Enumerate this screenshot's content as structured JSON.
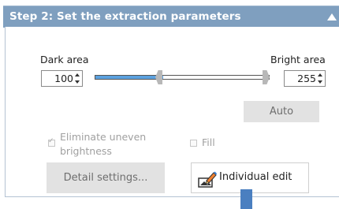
{
  "header": {
    "title": "Step 2: Set the extraction parameters"
  },
  "slider": {
    "dark_label": "Dark area",
    "bright_label": "Bright area",
    "dark_value": "100",
    "bright_value": "255",
    "dark_fill_fraction": 0.39,
    "bright_fraction": 1.0
  },
  "buttons": {
    "auto": "Auto",
    "detail_settings": "Detail settings...",
    "individual_edit": "Individual edit"
  },
  "options": {
    "eliminate_uneven": "Eliminate uneven brightness",
    "fill": "Fill",
    "eliminate_checked": true,
    "fill_checked": false
  },
  "colors": {
    "header_bg": "#7f9fbf",
    "slider_fill": "#5ba1df",
    "disabled_btn": "#e2e2e2"
  },
  "icons": {
    "collapse": "triangle-up",
    "individual_edit": "pencil-edit-icon"
  }
}
